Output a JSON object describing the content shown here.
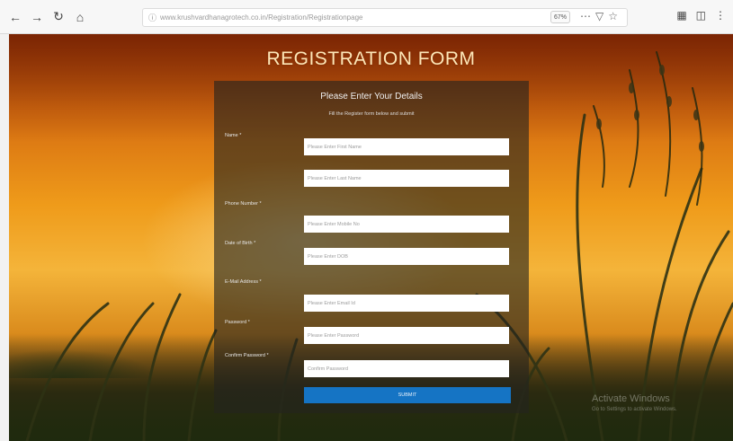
{
  "browser": {
    "url": "www.krushvardhanagrotech.co.in/Registration/Registrationpage",
    "zoom": "67%"
  },
  "page": {
    "title": "REGISTRATION FORM"
  },
  "form": {
    "heading": "Please Enter Your Details",
    "subheading": "Fill the Register form below and submit",
    "fields": [
      {
        "label": "Name *",
        "placeholder": "Please Enter First Name"
      },
      {
        "label": "",
        "placeholder": "Please Enter Last Name"
      },
      {
        "label": "Phone Number *",
        "placeholder": "Please Enter Mobile No"
      },
      {
        "label": "Date of Birth *",
        "placeholder": "Please Enter DOB"
      },
      {
        "label": "E-Mail Address *",
        "placeholder": "Please Enter Email Id"
      },
      {
        "label": "Password *",
        "placeholder": "Please Enter Password"
      },
      {
        "label": "Confirm Password *",
        "placeholder": "Confirm Password"
      }
    ],
    "submit_label": "SUBMIT"
  },
  "watermark": {
    "line1": "Activate Windows",
    "line2": "Go to Settings to activate Windows."
  },
  "colors": {
    "submit": "#1574c4",
    "card": "rgba(35,35,30,0.62)",
    "title": "#fde7b8"
  }
}
